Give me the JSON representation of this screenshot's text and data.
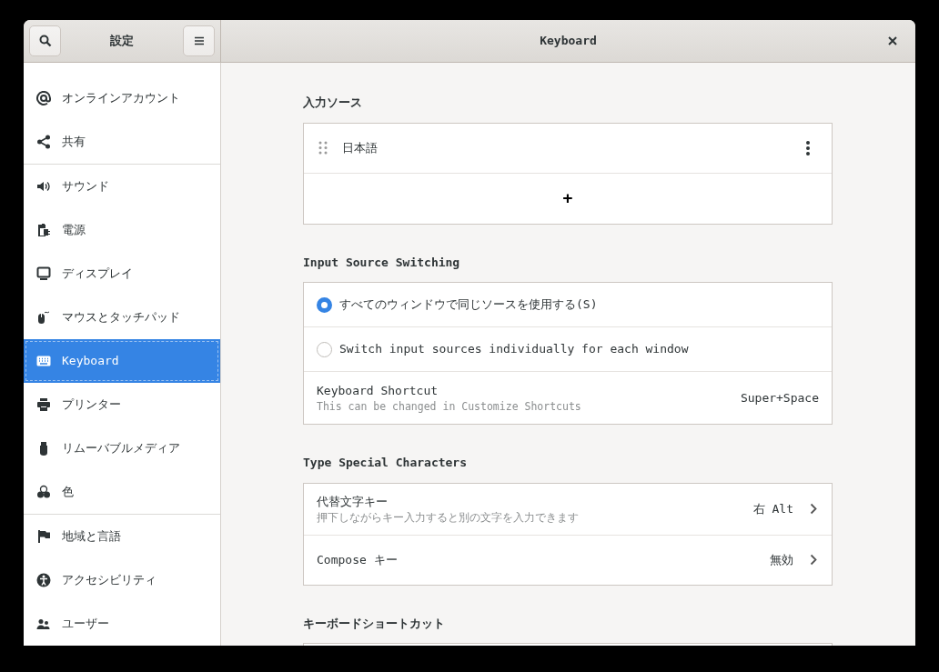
{
  "sidebar": {
    "title": "設定",
    "groups": [
      {
        "items": [
          {
            "label": "オンラインアカウント",
            "selected": false
          },
          {
            "label": "共有",
            "selected": false
          }
        ]
      },
      {
        "items": [
          {
            "label": "サウンド",
            "selected": false
          },
          {
            "label": "電源",
            "selected": false
          },
          {
            "label": "ディスプレイ",
            "selected": false
          },
          {
            "label": "マウスとタッチパッド",
            "selected": false
          },
          {
            "label": "Keyboard",
            "selected": true
          },
          {
            "label": "プリンター",
            "selected": false
          },
          {
            "label": "リムーバブルメディア",
            "selected": false
          },
          {
            "label": "色",
            "selected": false
          }
        ]
      },
      {
        "items": [
          {
            "label": "地域と言語",
            "selected": false
          },
          {
            "label": "アクセシビリティ",
            "selected": false
          },
          {
            "label": "ユーザー",
            "selected": false
          }
        ]
      }
    ]
  },
  "window": {
    "title": "Keyboard"
  },
  "input_sources": {
    "heading": "入力ソース",
    "items": [
      {
        "label": "日本語"
      }
    ],
    "add_button": "+"
  },
  "switching": {
    "heading": "Input Source Switching",
    "options": [
      {
        "label": "すべてのウィンドウで同じソースを使用する(S)",
        "selected": true
      },
      {
        "label": "Switch input sources individually for each window",
        "selected": false
      }
    ],
    "shortcut": {
      "label": "Keyboard Shortcut",
      "description": "This can be changed in Customize Shortcuts",
      "value": "Super+Space"
    }
  },
  "special_characters": {
    "heading": "Type Special Characters",
    "rows": [
      {
        "label": "代替文字キー",
        "description": "押下しながらキー入力すると別の文字を入力できます",
        "value": "右 Alt"
      },
      {
        "label": "Compose キー",
        "value": "無効"
      }
    ]
  },
  "keyboard_shortcuts": {
    "heading": "キーボードショートカット"
  }
}
